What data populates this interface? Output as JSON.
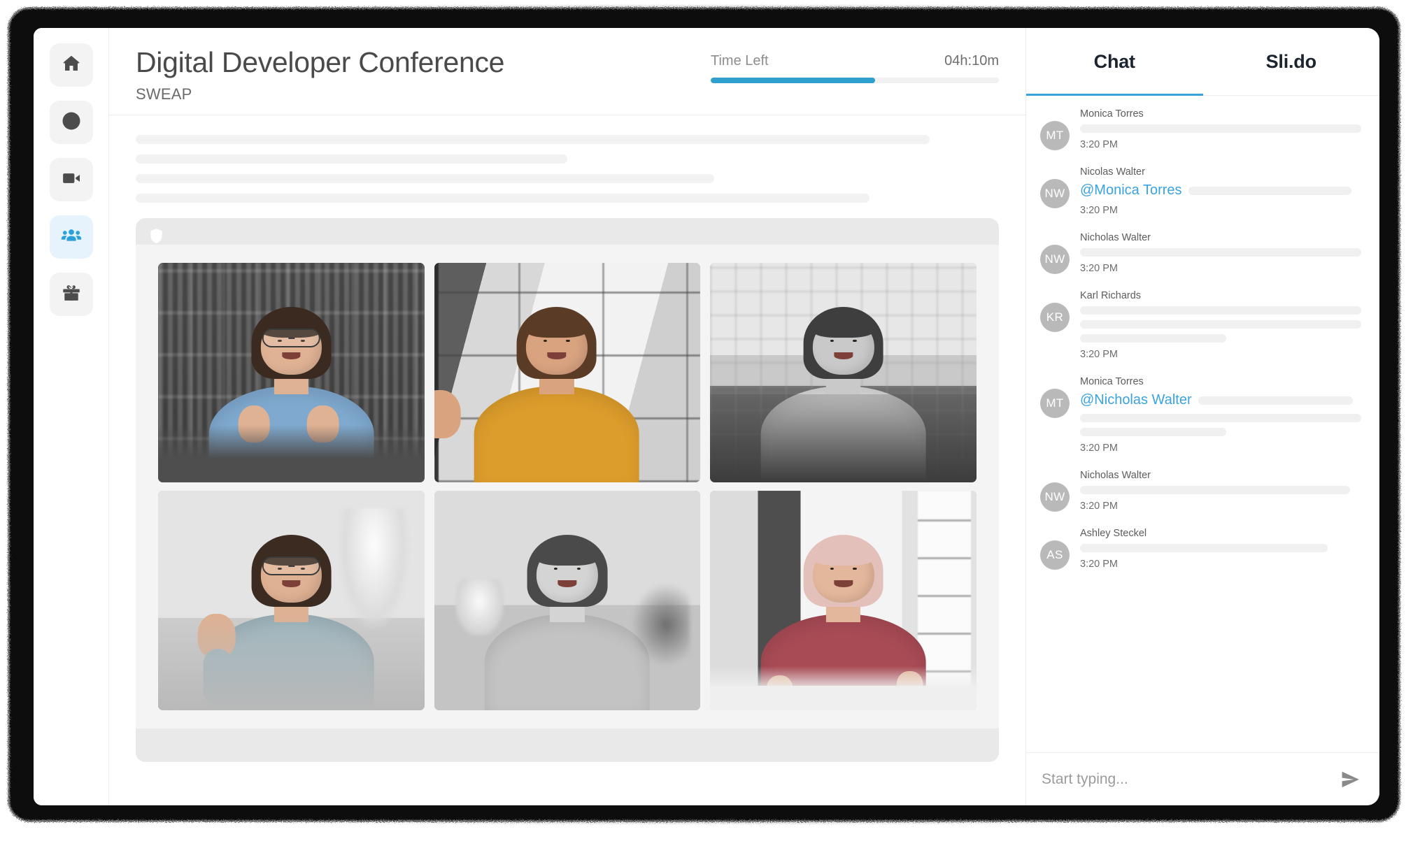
{
  "sidebar": {
    "items": [
      {
        "name": "home",
        "icon": "home-icon",
        "active": false
      },
      {
        "name": "schedule",
        "icon": "clock-icon",
        "active": false
      },
      {
        "name": "video",
        "icon": "video-icon",
        "active": false
      },
      {
        "name": "participants",
        "icon": "people-icon",
        "active": true
      },
      {
        "name": "rewards",
        "icon": "gift-icon",
        "active": false
      }
    ]
  },
  "header": {
    "title": "Digital Developer Conference",
    "subtitle": "SWEAP",
    "time_left_label": "Time Left",
    "time_left_value": "04h:10m",
    "time_left_percent": 57,
    "accent_color": "#2f9fce"
  },
  "content": {
    "placeholder_widths": [
      "92%",
      "50%",
      "67%",
      "85%"
    ],
    "stage": {
      "badge_icon": "shield-icon"
    }
  },
  "video_grid": {
    "tiles": [
      {
        "id": "tile-1",
        "scene": "bg-shelf",
        "shirt": "#7fa9cf",
        "skin": "#e0b294",
        "hair": "#3a2a20",
        "desk": "#565656",
        "glasses": true,
        "gesture": "talking"
      },
      {
        "id": "tile-2",
        "scene": "bg-window",
        "shirt": "#dd9d2c",
        "skin": "#d9a380",
        "hair": "#5a3b26",
        "desk": "#b9b9b9",
        "glasses": false,
        "gesture": "wave-left"
      },
      {
        "id": "tile-3",
        "scene": "bg-kitchen",
        "shirt": "#d9d9d9",
        "skin": "#c9c9c9",
        "hair": "#3e3e3e",
        "desk": "#4a4a4a",
        "glasses": false,
        "gesture": "none"
      },
      {
        "id": "tile-4",
        "scene": "bg-livingA",
        "shirt": "#9fb7bf",
        "skin": "#dfb193",
        "hair": "#3b2b20",
        "desk": "#c8c8c8",
        "glasses": true,
        "gesture": "wave-right"
      },
      {
        "id": "tile-5",
        "scene": "bg-livingB",
        "shirt": "#c3c3c3",
        "skin": "#d4d4d4",
        "hair": "#4a4a4a",
        "desk": "#bdbdbd",
        "glasses": false,
        "gesture": "none"
      },
      {
        "id": "tile-6",
        "scene": "bg-office",
        "shirt": "#a84b55",
        "skin": "#e3b79b",
        "hair": "#e4c0ba",
        "desk": "#ededed",
        "glasses": false,
        "gesture": "arms-crossed"
      }
    ]
  },
  "chat": {
    "tabs": [
      {
        "label": "Chat",
        "active": true
      },
      {
        "label": "Sli.do",
        "active": false
      }
    ],
    "mention_color": "#3aa3de",
    "messages": [
      {
        "author": "Monica Torres",
        "initials": "MT",
        "mention": null,
        "lines": [
          "100%"
        ],
        "time": "3:20 PM"
      },
      {
        "author": "Nicolas Walter",
        "initials": "NW",
        "mention": "@Monica Torres",
        "lines": [
          "58%"
        ],
        "time": "3:20 PM"
      },
      {
        "author": "Nicholas Walter",
        "initials": "NW",
        "mention": null,
        "lines": [
          "100%"
        ],
        "time": "3:20 PM"
      },
      {
        "author": "Karl Richards",
        "initials": "KR",
        "mention": null,
        "lines": [
          "100%",
          "100%",
          "52%"
        ],
        "time": "3:20 PM"
      },
      {
        "author": "Monica Torres",
        "initials": "MT",
        "mention": "@Nicholas Walter",
        "lines": [
          "55%",
          "100%",
          "52%"
        ],
        "time": "3:20 PM"
      },
      {
        "author": "Nicholas Walter",
        "initials": "NW",
        "mention": null,
        "lines": [
          "96%"
        ],
        "time": "3:20 PM"
      },
      {
        "author": "Ashley Steckel",
        "initials": "AS",
        "mention": null,
        "lines": [
          "88%"
        ],
        "time": "3:20 PM"
      }
    ],
    "input": {
      "placeholder": "Start typing...",
      "value": "",
      "send_icon": "send-icon"
    }
  }
}
